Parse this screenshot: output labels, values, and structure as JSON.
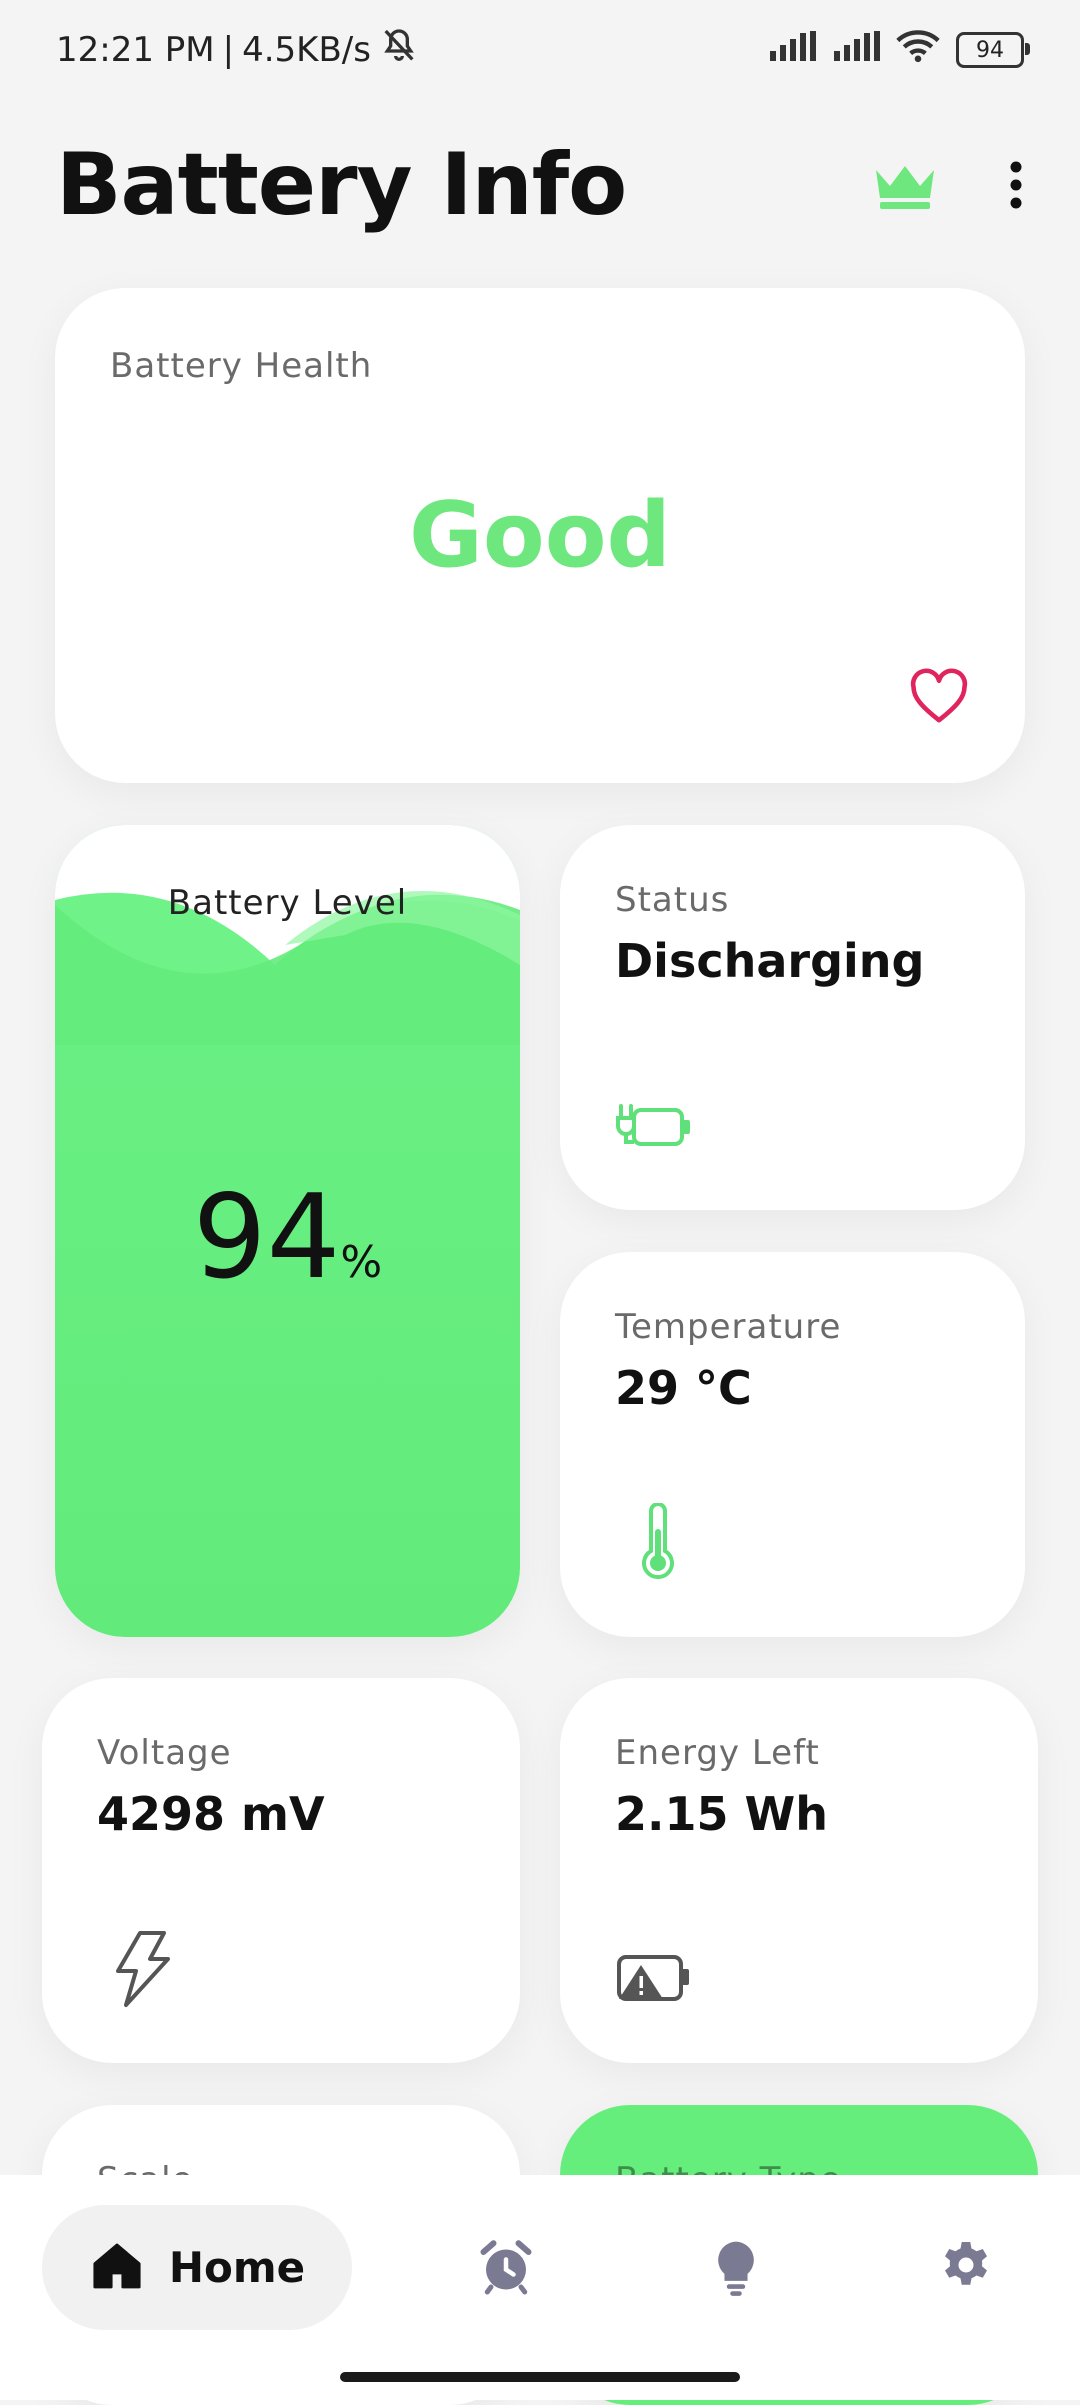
{
  "status_bar": {
    "time": "12:21 PM",
    "separator": "|",
    "network_speed": "4.5KB/s",
    "battery": "94",
    "icons": [
      "mute-icon",
      "signal-icon",
      "signal-icon",
      "wifi-icon",
      "battery-icon"
    ]
  },
  "app_bar": {
    "title": "Battery Info",
    "premium_icon": "crown-icon",
    "menu_icon": "more-vert-icon"
  },
  "health": {
    "label": "Battery Health",
    "value": "Good",
    "icon": "heart-icon"
  },
  "level": {
    "label": "Battery Level",
    "value": "94",
    "unit": "%",
    "fill_fraction": 0.94
  },
  "status": {
    "label": "Status",
    "value": "Discharging",
    "icon": "plug-battery-icon"
  },
  "temperature": {
    "label": "Temperature",
    "value": "29 °C",
    "icon": "thermometer-icon"
  },
  "voltage": {
    "label": "Voltage",
    "value": "4298 mV",
    "icon": "lightning-icon"
  },
  "energy": {
    "label": "Energy Left",
    "value": "2.15 Wh",
    "icon": "battery-warning-icon"
  },
  "scale": {
    "label": "Scale"
  },
  "battery_type": {
    "label": "Battery Type"
  },
  "bottom_nav": {
    "home_label": "Home",
    "items": [
      "home-icon",
      "alarm-icon",
      "bulb-icon",
      "settings-icon"
    ]
  },
  "colors": {
    "accent": "#66ee7c",
    "heart": "#e0245e",
    "nav_icon": "#7b7a93"
  }
}
